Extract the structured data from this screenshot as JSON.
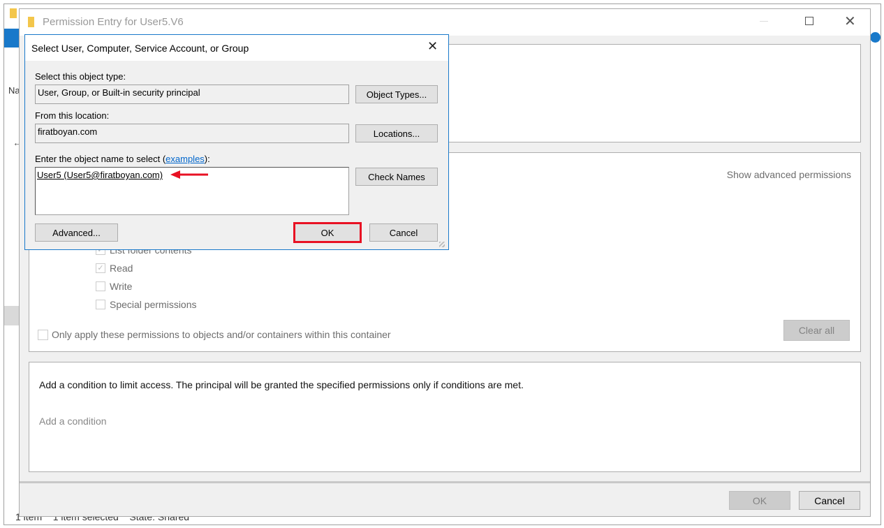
{
  "background_explorer": {
    "nav_fragment": "Na",
    "status": {
      "items": "1 item",
      "selected": "1 item selected",
      "state": "State:",
      "shared": "Shared"
    }
  },
  "permission_entry": {
    "title": "Permission Entry for User5.V6",
    "show_advanced": "Show advanced permissions",
    "permissions": [
      {
        "label": "List folder contents",
        "checked": true
      },
      {
        "label": "Read",
        "checked": true
      },
      {
        "label": "Write",
        "checked": false
      },
      {
        "label": "Special permissions",
        "checked": false
      }
    ],
    "only_apply": "Only apply these permissions to objects and/or containers within this container",
    "clear_all": "Clear all",
    "condition_text": "Add a condition to limit access. The principal will be granted the specified permissions only if conditions are met.",
    "add_condition": "Add a condition",
    "ok": "OK",
    "cancel": "Cancel"
  },
  "select_dialog": {
    "title": "Select User, Computer, Service Account, or Group",
    "object_type_label": "Select this object type:",
    "object_type_value": "User, Group, or Built-in security principal",
    "object_types_button": "Object Types...",
    "location_label": "From this location:",
    "location_value": "firatboyan.com",
    "locations_button": "Locations...",
    "enter_label_prefix": "Enter the object name to select (",
    "examples_link": "examples",
    "enter_label_suffix": "):",
    "object_name_value": "User5 (User5@firatboyan.com)",
    "check_names": "Check Names",
    "advanced": "Advanced...",
    "ok": "OK",
    "cancel": "Cancel",
    "highlight_color": "#e81123",
    "accent": "#1979ca"
  }
}
